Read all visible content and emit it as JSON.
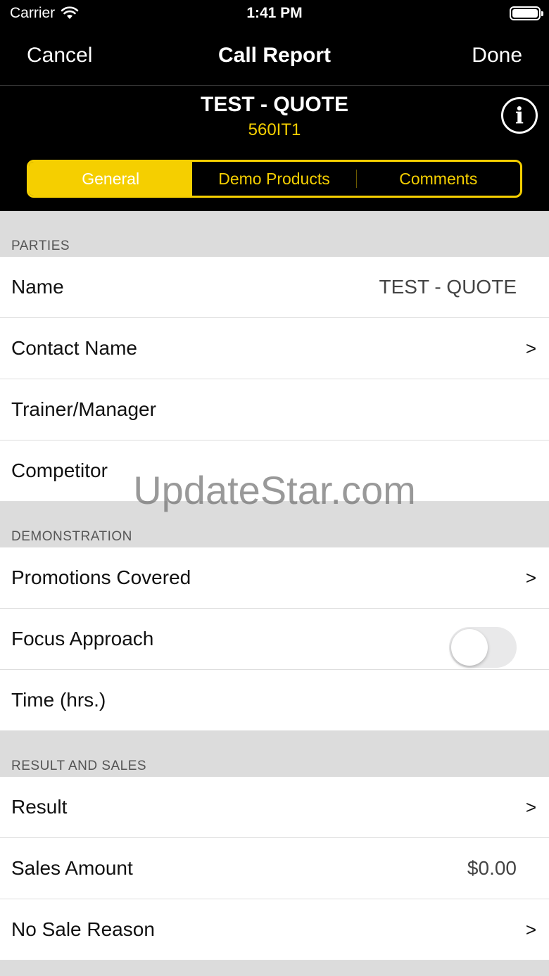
{
  "status_bar": {
    "carrier": "Carrier",
    "time": "1:41 PM"
  },
  "nav": {
    "cancel": "Cancel",
    "title": "Call Report",
    "done": "Done"
  },
  "header": {
    "title": "TEST - QUOTE",
    "code": "560IT1"
  },
  "tabs": [
    {
      "label": "General",
      "selected": true
    },
    {
      "label": "Demo Products",
      "selected": false
    },
    {
      "label": "Comments",
      "selected": false
    }
  ],
  "sections": {
    "parties": {
      "title": "PARTIES",
      "rows": {
        "name": {
          "label": "Name",
          "value": "TEST - QUOTE"
        },
        "contact_name": {
          "label": "Contact Name",
          "chevron": ">"
        },
        "trainer_manager": {
          "label": "Trainer/Manager"
        },
        "competitor": {
          "label": "Competitor"
        }
      }
    },
    "demonstration": {
      "title": "DEMONSTRATION",
      "rows": {
        "promotions_covered": {
          "label": "Promotions Covered",
          "chevron": ">"
        },
        "focus_approach": {
          "label": "Focus Approach",
          "toggle_on": false
        },
        "time": {
          "label": "Time (hrs.)"
        }
      }
    },
    "result_sales": {
      "title": "RESULT AND SALES",
      "rows": {
        "result": {
          "label": "Result",
          "chevron": ">"
        },
        "sales_amount": {
          "label": "Sales Amount",
          "value": "$0.00"
        },
        "no_sale_reason": {
          "label": "No Sale Reason",
          "chevron": ">"
        }
      }
    }
  },
  "watermark": "UpdateStar.com",
  "colors": {
    "accent": "#f5cf00",
    "nav_background": "#000000",
    "section_background": "#dcdcdc"
  }
}
